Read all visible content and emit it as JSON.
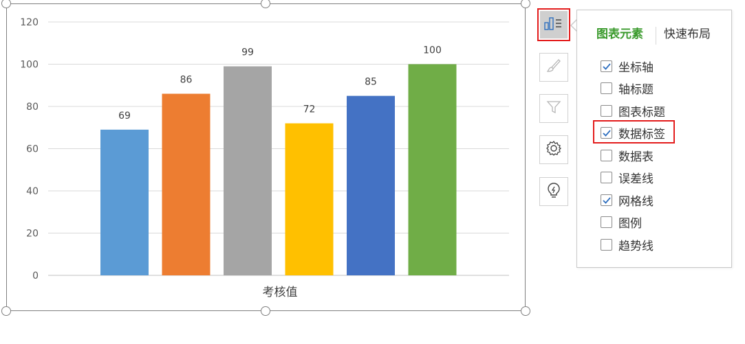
{
  "chart_data": {
    "type": "bar",
    "categories": [
      "",
      "",
      "",
      "",
      "",
      ""
    ],
    "values": [
      69,
      86,
      99,
      72,
      85,
      100
    ],
    "colors": [
      "#5b9bd5",
      "#ed7d31",
      "#a5a5a5",
      "#ffc000",
      "#4472c4",
      "#70ad47"
    ],
    "xlabel": "考核值",
    "ylabel": "",
    "title": "",
    "ylim": [
      0,
      120
    ],
    "yticks": [
      0,
      20,
      40,
      60,
      80,
      100,
      120
    ],
    "grid": true,
    "data_labels": true,
    "legend": "none"
  },
  "side_toolbar": {
    "buttons": [
      {
        "icon": "chart-elements-icon",
        "active": true
      },
      {
        "icon": "brush-icon",
        "active": false
      },
      {
        "icon": "filter-icon",
        "active": false
      },
      {
        "icon": "gear-icon",
        "active": false
      },
      {
        "icon": "lightbulb-icon",
        "active": false
      }
    ]
  },
  "panel": {
    "tabs": [
      "图表元素",
      "快速布局"
    ],
    "active_tab": 0,
    "options": [
      {
        "label": "坐标轴",
        "checked": true
      },
      {
        "label": "轴标题",
        "checked": false
      },
      {
        "label": "图表标题",
        "checked": false
      },
      {
        "label": "数据标签",
        "checked": true
      },
      {
        "label": "数据表",
        "checked": false
      },
      {
        "label": "误差线",
        "checked": false
      },
      {
        "label": "网格线",
        "checked": true
      },
      {
        "label": "图例",
        "checked": false
      },
      {
        "label": "趋势线",
        "checked": false
      }
    ]
  },
  "colors": {
    "accent_green": "#3a9a2c",
    "highlight_red": "#e31b1b",
    "checkmark_blue": "#2f6fbf"
  }
}
